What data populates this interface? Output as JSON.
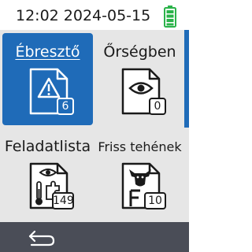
{
  "status": {
    "clock": "12:02 2024-05-15",
    "battery_icon": "battery-full-icon",
    "battery_color": "#2bb34a"
  },
  "tiles": [
    {
      "label": "Ébresztő",
      "badge": "6",
      "icon": "alert-document-icon",
      "selected": true
    },
    {
      "label": "Őrségben",
      "badge": "0",
      "icon": "eye-document-icon",
      "selected": false
    },
    {
      "label": "Feladatlista",
      "badge": "149",
      "icon": "eye-thermometer-puzzle-icon",
      "selected": false
    },
    {
      "label": "Friss tehének",
      "badge": "10",
      "icon": "cow-f-document-icon",
      "selected": false
    }
  ],
  "nav": {
    "back_icon": "back-arrow-icon"
  },
  "colors": {
    "accent": "#1f6bb8",
    "tile_bg": "#e6e6e6",
    "bottom_bar": "#4a4d57"
  }
}
